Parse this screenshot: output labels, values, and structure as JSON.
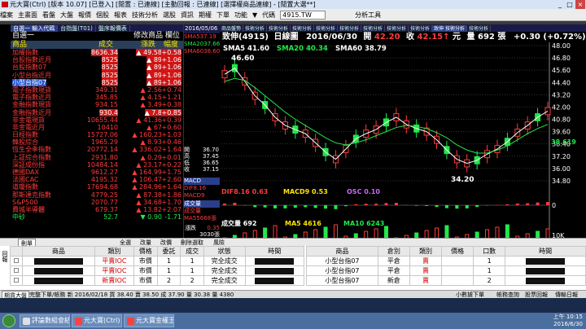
{
  "window": {
    "title": "元大寶(Ctrl) [版本 10.07] [已登入] [閒置 : 已連線] [主動回報 : 已連線] [選擇權商品連線] - [閒置大選**]",
    "icon": "app-icon"
  },
  "menu": {
    "items": [
      "檔案",
      "主畫面",
      "看盤",
      "大盤",
      "報價",
      "個股",
      "報表",
      "技術分析",
      "選股",
      "資訊",
      "期權",
      "下單",
      "功能",
      "▼"
    ],
    "code_label": "代碼",
    "code_value": "4915.TW",
    "analysis_btn": "分析工具"
  },
  "left": {
    "tabs": [
      "自選一 輸入代碼",
      "台指盤(T01)",
      "盤序報價表"
    ],
    "header": "自選一",
    "header_right": "修改商品 欄位",
    "cols": {
      "name": "商品",
      "price": "成交",
      "chg": "漲跌",
      "pct": "幅度"
    },
    "rows": [
      {
        "name": "加權指數",
        "price": "8636.34",
        "chg": "▲ 49.58",
        "pct": "+0.58",
        "t": "r",
        "hl": true
      },
      {
        "name": "台股指數近月",
        "price": "8525",
        "chg": "▲ 89",
        "pct": "+1.06",
        "t": "r",
        "hl": true
      },
      {
        "name": "台股指數07",
        "price": "8525",
        "chg": "▲ 89",
        "pct": "+1.06",
        "t": "r",
        "hl": true
      },
      {
        "name": "小型台指近月",
        "price": "8525",
        "chg": "▲ 89",
        "pct": "+1.06",
        "t": "r",
        "hl": true
      },
      {
        "name": "小型台指07",
        "price": "8525",
        "chg": "▲ 89",
        "pct": "+1.06",
        "t": "r",
        "hl": true,
        "sel": true
      },
      {
        "name": "電子指數現貨",
        "price": "349.31",
        "chg": "▲ 2.56",
        "pct": "+0.74",
        "t": "r"
      },
      {
        "name": "電子指數近月",
        "price": "345.85",
        "chg": "▲ 4.15",
        "pct": "+1.21",
        "t": "r"
      },
      {
        "name": "金融指數現貨",
        "price": "934.15",
        "chg": "▲ 3.49",
        "pct": "+0.38",
        "t": "r"
      },
      {
        "name": "金融指數近月",
        "price": "930.4",
        "chg": "▲ 7.8",
        "pct": "+0.85",
        "t": "r",
        "hl": true
      },
      {
        "name": "非金電現貨",
        "price": "10655.44",
        "chg": "▲ 41.36",
        "pct": "+0.39",
        "t": "r"
      },
      {
        "name": "非金電近月",
        "price": "10410",
        "chg": "▲ 67",
        "pct": "+0.60",
        "t": "r"
      },
      {
        "name": "日經指數",
        "price": "15727.06",
        "chg": "▲ 160.23",
        "pct": "+1.03",
        "t": "r"
      },
      {
        "name": "韓股綜合",
        "price": "1965.29",
        "chg": "▲ 8.93",
        "pct": "+0.46",
        "t": "r"
      },
      {
        "name": "恆生全季指數",
        "price": "20772.14",
        "chg": "▲ 336.02",
        "pct": "+1.64",
        "t": "r"
      },
      {
        "name": "上証綜合指數",
        "price": "2931.80",
        "chg": "▲ 0.29",
        "pct": "+0.01",
        "t": "r"
      },
      {
        "name": "深証成份指",
        "price": "10484.14",
        "chg": "▲ 23.17",
        "pct": "+0.22",
        "t": "r"
      },
      {
        "name": "德國DAX",
        "price": "9612.27",
        "chg": "▲ 164.99",
        "pct": "+1.75",
        "t": "r"
      },
      {
        "name": "法國CAC",
        "price": "4195.32",
        "chg": "▲ 106.47",
        "pct": "+2.60",
        "t": "r"
      },
      {
        "name": "道瓊指數",
        "price": "17694.68",
        "chg": "▲ 284.96",
        "pct": "+1.64",
        "t": "r"
      },
      {
        "name": "那斯達克指數",
        "price": "4779.25",
        "chg": "▲ 87.38",
        "pct": "+1.86",
        "t": "r"
      },
      {
        "name": "S&P500",
        "price": "2070.77",
        "chg": "▲ 34.68",
        "pct": "+1.70",
        "t": "r"
      },
      {
        "name": "費城半導體",
        "price": "679.37",
        "chg": "▲ 13.82",
        "pct": "+2.07",
        "t": "r"
      },
      {
        "name": "中砂",
        "price": "52.7",
        "chg": "▼ 0.90",
        "pct": "-1.71",
        "t": "g"
      }
    ]
  },
  "mid": {
    "date": "2016/05/06",
    "ma": [
      {
        "l": "SMA537.19",
        "c": "#ff3b3b"
      },
      {
        "l": "SMA2037.66",
        "c": "#22e84a"
      },
      {
        "l": "SMA6038.60",
        "c": "#ff3b3b"
      }
    ],
    "quote": [
      [
        "開",
        "36.70"
      ],
      [
        "高",
        "37.45"
      ],
      [
        "低",
        "36.65"
      ],
      [
        "收",
        "37.15"
      ]
    ],
    "vol_lbl": "漲跌",
    "vol_chg": "0.35",
    "vol_val": "3030張",
    "tabs": [
      "MACD",
      "DIF8.16",
      "MACD9"
    ],
    "vtabs": [
      "成交量",
      "成交量",
      "MA55668張"
    ]
  },
  "chart": {
    "tabs": [
      "商品盤勢",
      "技術分析",
      "技術分析",
      "技術分析",
      "技術分析",
      "技術分析",
      "技術分析",
      "技術分析",
      "技術分析",
      "致伸 技術分析",
      "技術分析"
    ],
    "stock": "致伸(4915)",
    "type": "日線圖",
    "date": "2016/06/30",
    "open_lbl": "開",
    "open": "42.20",
    "close_lbl": "收",
    "close": "42.15",
    "unit": "元",
    "vol_lbl": "量",
    "vol": "692",
    "vol_unit": "張",
    "chg": "+0.30",
    "pct": "(+0.72%)",
    "legend": [
      {
        "t": "SMA5 41.60",
        "c": "#ffffff"
      },
      {
        "t": "SMA20 40.34",
        "c": "#22e84a"
      },
      {
        "t": "SMA60 38.79",
        "c": "#ffffff"
      }
    ],
    "high_label": "46.60",
    "low_label": "34.20",
    "last_price": "38.619",
    "macd_label": "DIF8.16 0.63",
    "macd9_label": "MACD9 0.53",
    "osc_label": "OSC 0.10",
    "vol_bar_label": "成交量 692",
    "vol_ma5_label": "MA5 4616",
    "vol_ma10_label": "MA10 6243",
    "dates": [
      "2015/09/21",
      "12",
      "2016/01",
      "02",
      "03",
      "04",
      "2016/05/06",
      "06"
    ]
  },
  "chart_data": {
    "type": "line",
    "title": "致伸(4915) 日線圖 2016/06/30",
    "ylim": [
      34,
      48
    ],
    "yticks": [
      48.0,
      46.8,
      45.6,
      44.4,
      43.2,
      42.0,
      40.8,
      39.6,
      38.4,
      37.2,
      36.0,
      34.8
    ],
    "xlabels": [
      "2015/09/21",
      "12",
      "2016/01",
      "02",
      "03",
      "04",
      "2016/05/06",
      "06"
    ],
    "series": [
      {
        "name": "SMA5",
        "values": [
          45.2,
          45.8,
          44.5,
          43.1,
          42.2,
          41.0,
          40.2,
          39.8,
          39.4,
          38.5,
          37.6,
          36.9,
          37.9,
          38.9,
          39.4,
          39.8,
          40.5,
          41.0,
          40.3,
          39.9,
          39.6,
          38.8,
          37.8,
          36.9,
          36.5,
          36.8,
          37.4,
          37.9,
          38.6,
          39.5,
          40.2,
          41.0,
          41.6
        ]
      },
      {
        "name": "SMA20",
        "values": [
          44.5,
          44.8,
          44.6,
          43.9,
          43.1,
          42.3,
          41.5,
          40.8,
          40.2,
          39.6,
          39.0,
          38.5,
          38.3,
          38.5,
          38.8,
          39.2,
          39.6,
          40.0,
          40.2,
          40.1,
          39.9,
          39.5,
          39.0,
          38.3,
          37.8,
          37.5,
          37.5,
          37.8,
          38.2,
          38.8,
          39.4,
          39.9,
          40.3
        ]
      }
    ],
    "vol_ylabel": "10K",
    "macd_zero": "0"
  },
  "orders": {
    "toolbar": [
      "刪單",
      "全選",
      "改量",
      "改價",
      "刪除選取",
      "風險"
    ],
    "left_cols": [
      "",
      "商品",
      "類別",
      "價格",
      "委託",
      "成交",
      "狀態",
      "時間"
    ],
    "left_rows": [
      [
        "",
        "平賣IOC",
        "市價",
        "1",
        "1",
        "完全成交"
      ],
      [
        "",
        "平賣IOC",
        "市價",
        "1",
        "1",
        "完全成交"
      ],
      [
        "",
        "新賣IOC",
        "市價",
        "2",
        "2",
        "完全成交"
      ]
    ],
    "right_cols": [
      "商品",
      "倉別",
      "類別",
      "價格",
      "口數",
      "時間"
    ],
    "right_rows": [
      [
        "小型台指07",
        "平倉",
        "賣",
        "",
        "1"
      ],
      [
        "小型台指07",
        "平倉",
        "賣",
        "",
        "1"
      ],
      [
        "小型台指07",
        "新倉",
        "賣",
        "",
        "2"
      ]
    ],
    "side_label": "回報"
  },
  "status": {
    "left": "期貨大盤",
    "mid": "完整下單/帳務  新 2016/02/18 買 38.40 賣 38.50 成 37.90 量 30.38 量 4380",
    "r1": "小數據下單",
    "r2": "帳務查詢",
    "r3": "股票回報",
    "r4": "傳輸日報"
  },
  "taskbar": {
    "items": [
      {
        "t": "評論數組會結束主...",
        "c": "#e0e0e0"
      },
      {
        "t": "元大寶(Ctrl) [版本 1...",
        "c": "#ff4040"
      },
      {
        "t": "元大寶金權王 - 選時...",
        "c": "#ff4040"
      }
    ],
    "time": "上午 10:15",
    "date": "2016/6/30"
  },
  "colors": {
    "up": "#ff3b3b",
    "down": "#22e84a",
    "highlight": "#d01515",
    "header": "#2a3f5a",
    "accent": "#ffe400"
  }
}
